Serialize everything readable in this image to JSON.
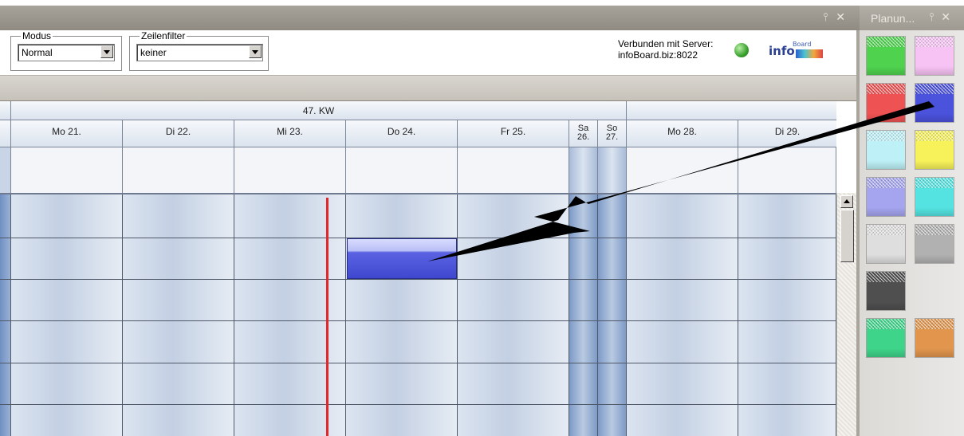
{
  "main_window": {
    "icons": [
      "pin-icon",
      "close-icon"
    ]
  },
  "toolbar": {
    "modus": {
      "label": "Modus",
      "value": "Normal"
    },
    "zeilenfilter": {
      "label": "Zeilenfilter",
      "value": "keiner"
    },
    "server": {
      "line1": "Verbunden mit Server:",
      "line2": "infoBoard.biz:8022",
      "status_color": "#3aa12e"
    },
    "logo": {
      "text": "info",
      "sup": "Board"
    }
  },
  "calendar": {
    "week_label": "47. KW",
    "days": [
      {
        "label": "Mo 21."
      },
      {
        "label": "Di 22."
      },
      {
        "label": "Mi 23."
      },
      {
        "label": "Do 24."
      },
      {
        "label": "Fr 25."
      },
      {
        "line1": "Sa",
        "line2": "26."
      },
      {
        "line1": "So",
        "line2": "27."
      },
      {
        "label": "Mo 28."
      },
      {
        "label": "Di 29."
      }
    ],
    "today_line_color": "#e8242a",
    "event_color": "#3f47cf"
  },
  "palette": {
    "title": "Planun...",
    "icons": [
      "pin-icon",
      "close-icon"
    ],
    "swatches": [
      "#4fd34f",
      "#f7c2f4",
      "#ef5252",
      "#4b52dc",
      "#bdf1f7",
      "#f7f25a",
      "#a4a4ef",
      "#54e3e1",
      "#dedede",
      "#b1b1b1",
      "#4f4f4f",
      "#3ed48a",
      "#e1954d"
    ]
  }
}
